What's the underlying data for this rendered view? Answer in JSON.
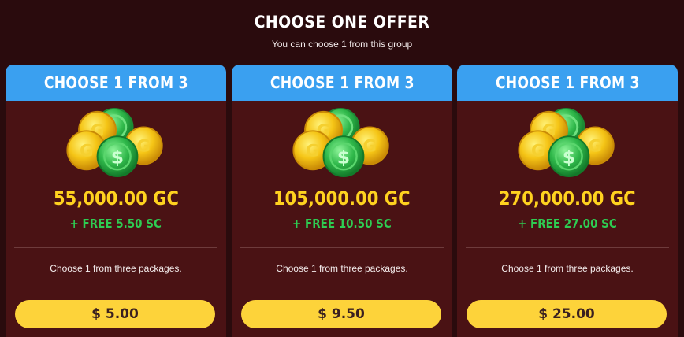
{
  "header": {
    "title": "CHOOSE ONE OFFER",
    "subtitle": "You can choose 1 from this group"
  },
  "offers": [
    {
      "heading": "CHOOSE 1 FROM 3",
      "gc_amount": "55,000.00 GC",
      "sc_bonus": "+ FREE 5.50 SC",
      "description": "Choose 1 from three packages.",
      "price": "$ 5.00",
      "icon": "coins-icon"
    },
    {
      "heading": "CHOOSE 1 FROM 3",
      "gc_amount": "105,000.00 GC",
      "sc_bonus": "+ FREE 10.50 SC",
      "description": "Choose 1 from three packages.",
      "price": "$ 9.50",
      "icon": "coins-icon"
    },
    {
      "heading": "CHOOSE 1 FROM 3",
      "gc_amount": "270,000.00 GC",
      "sc_bonus": "+ FREE 27.00 SC",
      "description": "Choose 1 from three packages.",
      "price": "$ 25.00",
      "icon": "coins-icon"
    }
  ],
  "colors": {
    "background": "#2a0b0d",
    "card": "#4a1214",
    "card_header": "#3aa0f0",
    "gold_text": "#ffd21f",
    "green_text": "#2ecc52",
    "button": "#fdd33a"
  }
}
